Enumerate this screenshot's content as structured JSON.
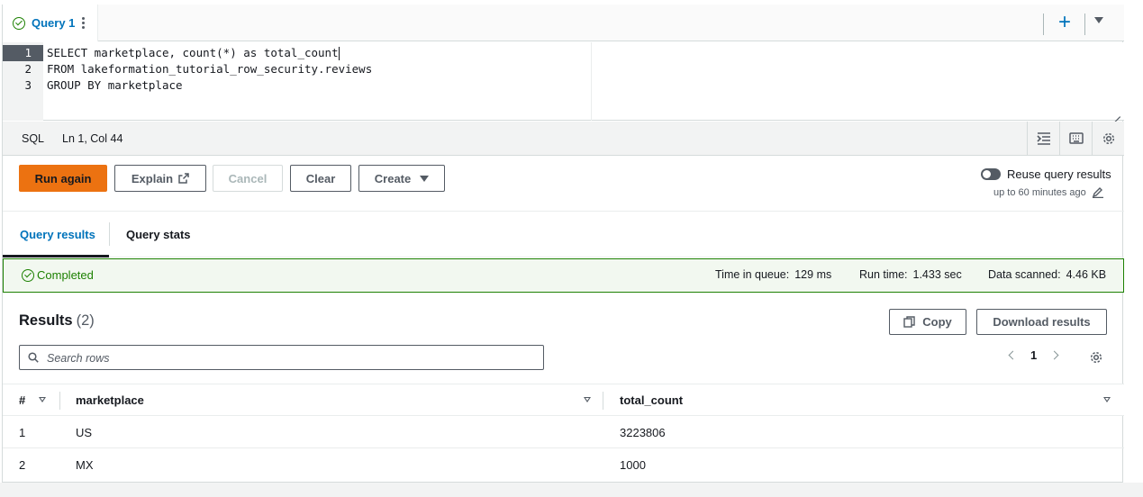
{
  "query_tab": {
    "label": "Query 1"
  },
  "tabbar": {
    "add_symbol": "+"
  },
  "editor": {
    "line_numbers": [
      "1",
      "2",
      "3"
    ],
    "lines": [
      [
        "SELECT",
        " marketplace, count(*) as total_count"
      ],
      [
        "FROM",
        " lakeformation_tutorial_row_security.reviews"
      ],
      [
        "GROUP BY",
        " marketplace"
      ]
    ]
  },
  "statusbar": {
    "language": "SQL",
    "position": "Ln 1, Col 44"
  },
  "toolbar": {
    "run_again": "Run again",
    "explain": "Explain",
    "cancel": "Cancel",
    "clear": "Clear",
    "create": "Create",
    "reuse_label": "Reuse query results",
    "reuse_sub": "up to 60 minutes ago"
  },
  "result_tabs": {
    "results": "Query results",
    "stats": "Query stats"
  },
  "banner": {
    "status": "Completed",
    "queue_label": "Time in queue:",
    "queue_value": "129 ms",
    "run_label": "Run time:",
    "run_value": "1.433 sec",
    "scanned_label": "Data scanned:",
    "scanned_value": "4.46 KB"
  },
  "results": {
    "title": "Results",
    "count": "(2)",
    "copy": "Copy",
    "download": "Download results",
    "search_placeholder": "Search rows",
    "page": "1"
  },
  "table": {
    "headers": {
      "index": "#",
      "marketplace": "marketplace",
      "total_count": "total_count"
    },
    "rows": [
      {
        "index": "1",
        "marketplace": "US",
        "total_count": "3223806"
      },
      {
        "index": "2",
        "marketplace": "MX",
        "total_count": "1000"
      }
    ]
  },
  "colors": {
    "accent": "#0073bb",
    "primary_button": "#ec7211",
    "success": "#1d8102"
  }
}
